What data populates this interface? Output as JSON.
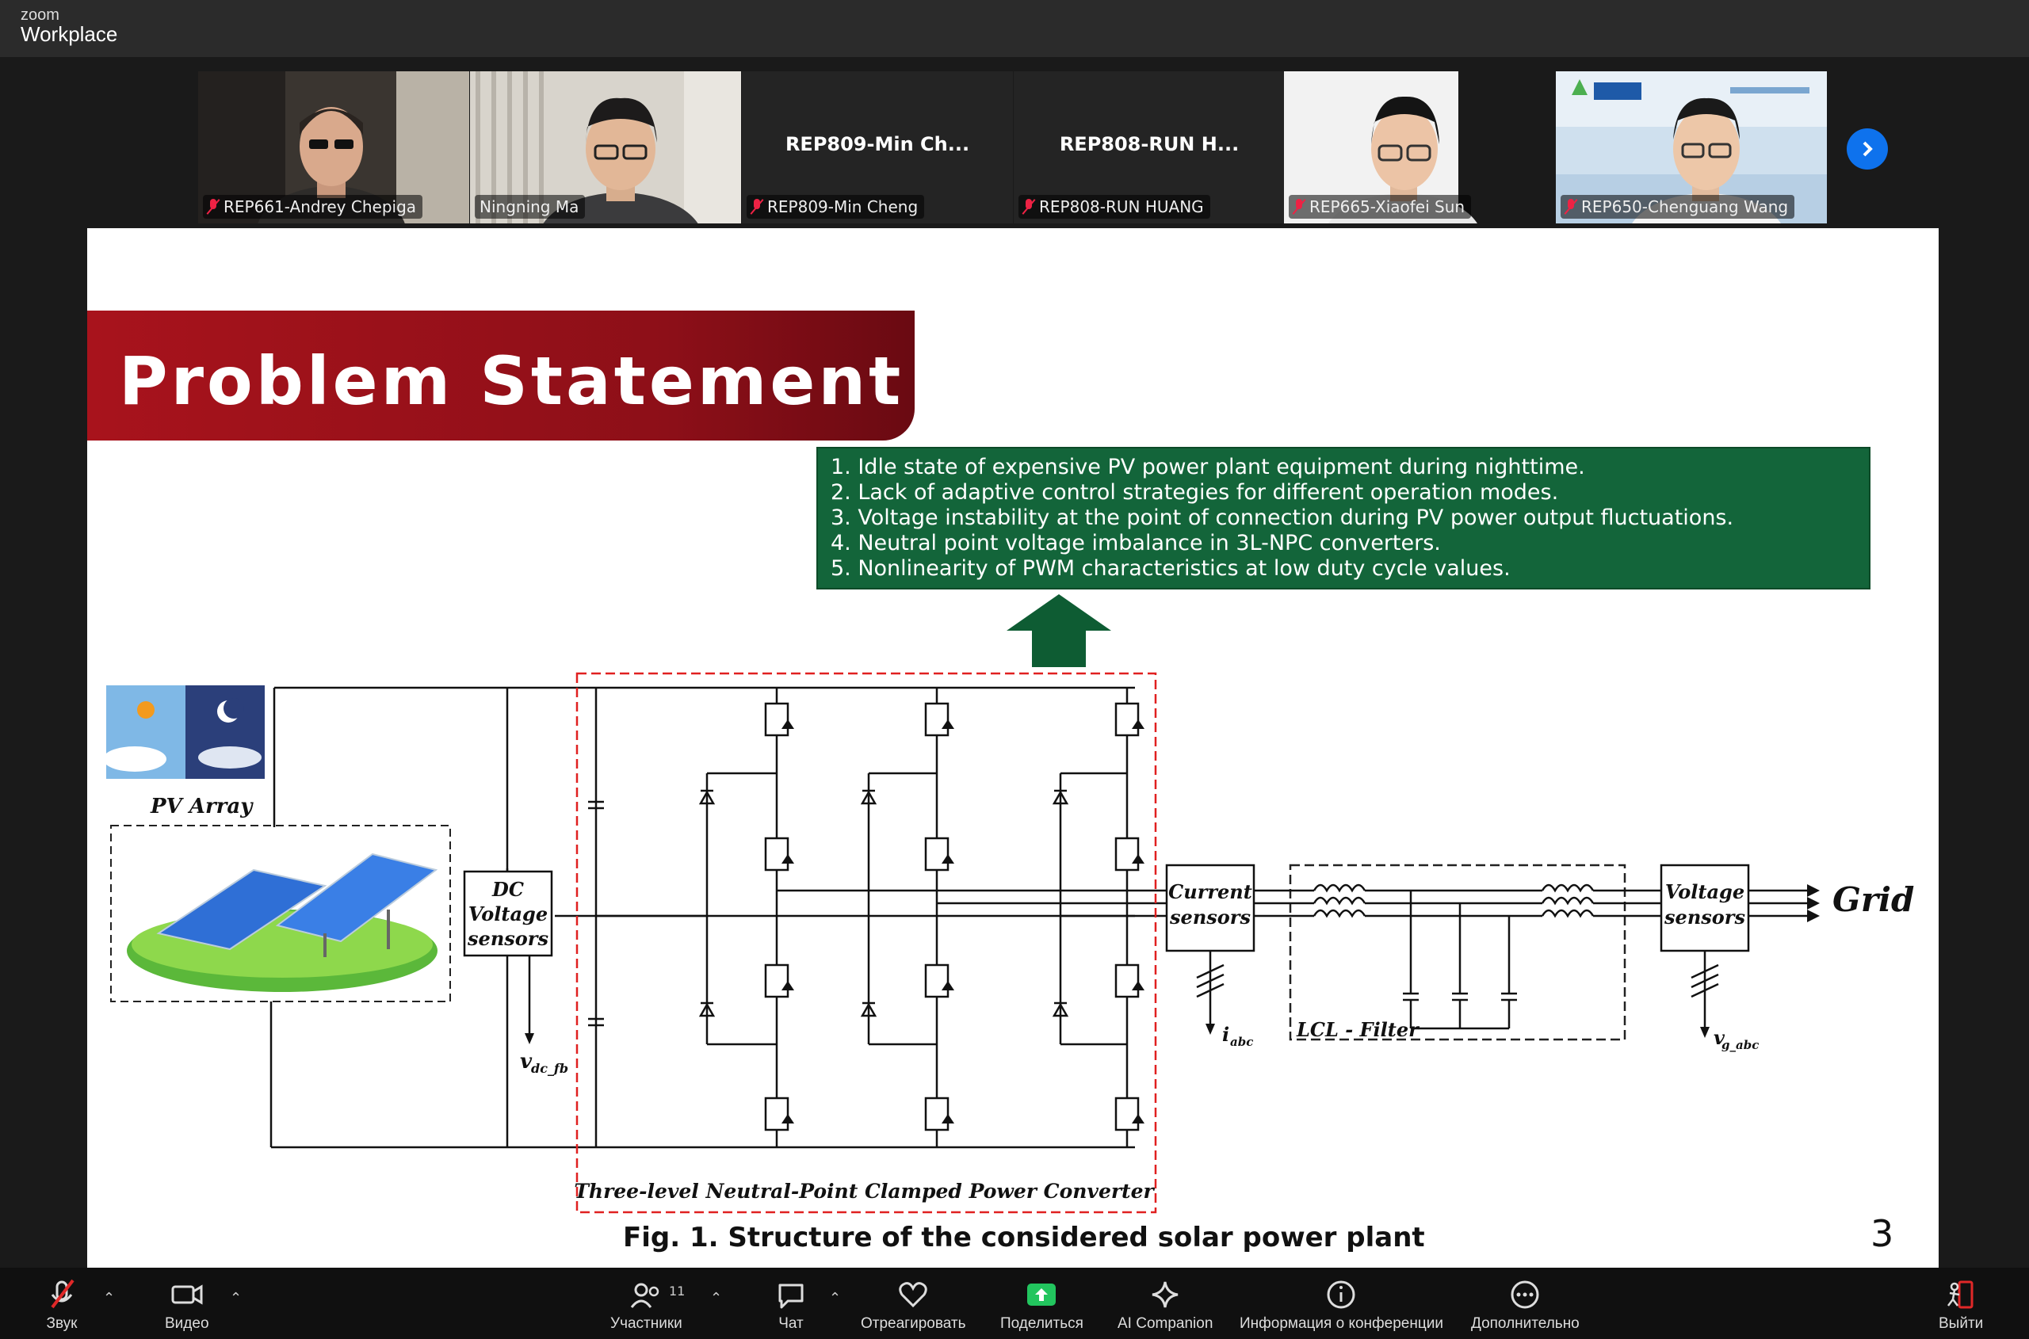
{
  "app": {
    "brand_small": "zoom",
    "brand_large": "Workplace"
  },
  "participants": [
    {
      "name": "REP661-Andrey Chepiga",
      "muted": true,
      "video": true
    },
    {
      "name": "Ningning Ma",
      "muted": false,
      "video": true
    },
    {
      "name": "REP809-Min Cheng",
      "display": "REP809-Min  Ch...",
      "muted": true,
      "video": false
    },
    {
      "name": "REP808-RUN HUANG",
      "display": "REP808-RUN  H...",
      "muted": true,
      "video": false
    },
    {
      "name": "REP665-Xiaofei Sun",
      "muted": true,
      "video": true
    },
    {
      "name": "REP650-Chenguang Wang",
      "muted": true,
      "video": true
    }
  ],
  "slide": {
    "title": "Problem Statement",
    "problems": [
      "1. Idle state of expensive PV power plant equipment during nighttime.",
      "2. Lack of adaptive control strategies for different operation modes.",
      "3. Voltage instability at the point of connection during PV power output fluctuations.",
      "4. Neutral point voltage imbalance in 3L-NPC converters.",
      "5. Nonlinearity of PWM characteristics at low duty cycle values."
    ],
    "diagram": {
      "pv_array": "PV Array",
      "dc_sensor": [
        "DC",
        "Voltage",
        "sensors"
      ],
      "vdc_main": "v",
      "vdc_sub": "dc_fb",
      "converter_label": "Three-level Neutral-Point Clamped Power Converter",
      "current_sensor": [
        "Current",
        "sensors"
      ],
      "iabc_main": "i",
      "iabc_sub": "abc",
      "filter_label": "LCL - Filter",
      "voltage_sensor": [
        "Voltage",
        "sensors"
      ],
      "vg_main": "v",
      "vg_sub": "g_abc",
      "grid": "Grid"
    },
    "caption": "Fig. 1. Structure of the considered solar power plant",
    "page_number": "3"
  },
  "toolbar": {
    "audio": "Звук",
    "video": "Видео",
    "participants": "Участники",
    "participants_count": "11",
    "chat": "Чат",
    "react": "Отреагировать",
    "share": "Поделиться",
    "ai": "AI Companion",
    "info": "Информация о конференции",
    "more": "Дополнительно",
    "leave": "Выйти"
  },
  "colors": {
    "accent": "#0e72ed",
    "share": "#22c55e",
    "banner": "#a8131c",
    "problems_bg": "#13653a",
    "leave": "#e02828"
  }
}
